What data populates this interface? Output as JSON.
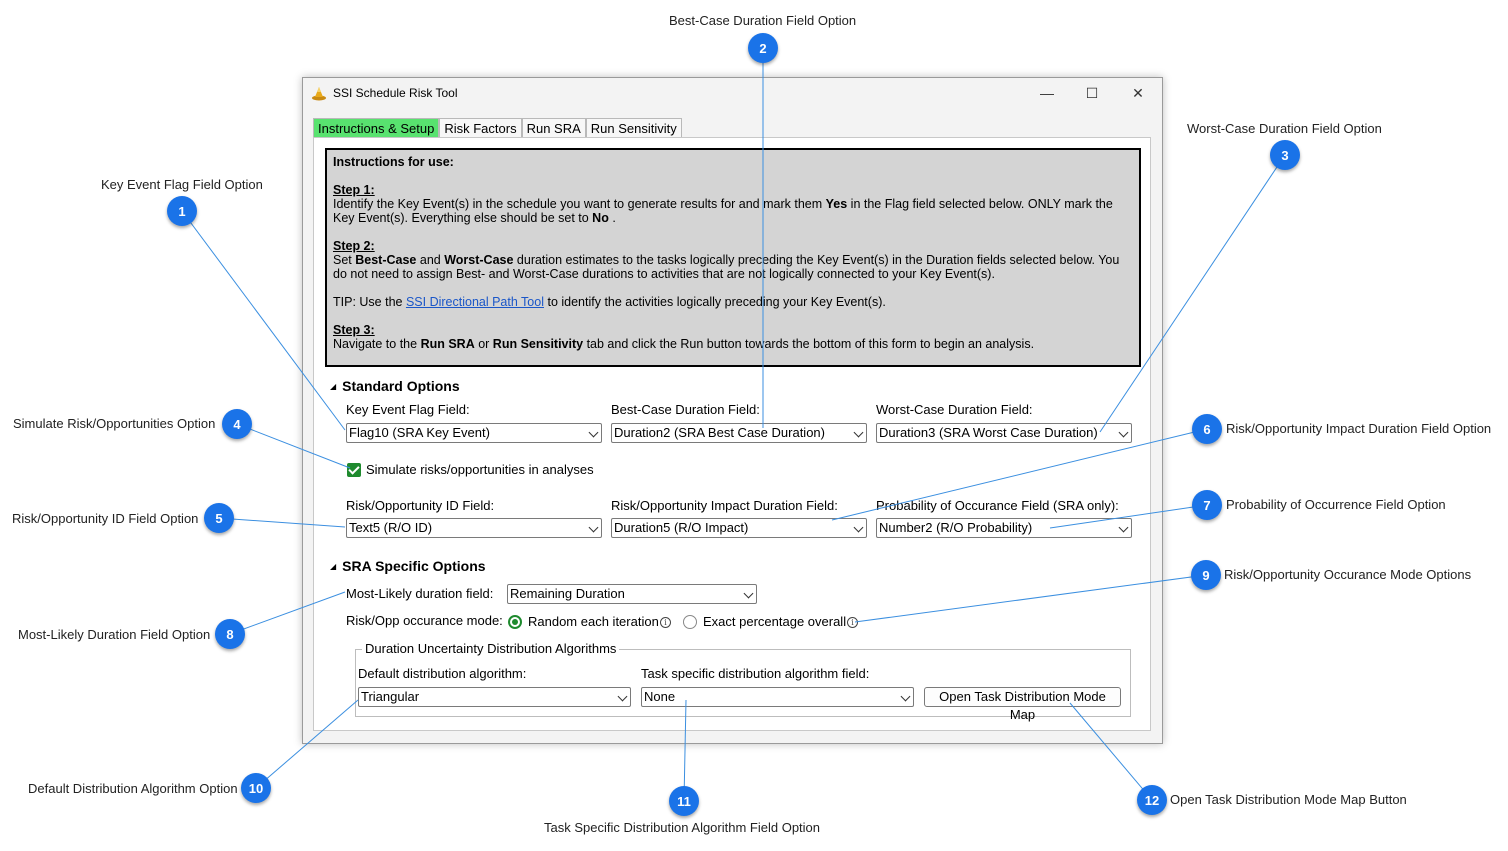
{
  "window": {
    "title": "SSI Schedule Risk Tool",
    "controls": {
      "minimize": "—",
      "maximize": "☐",
      "close": "✕"
    }
  },
  "tabs": [
    "Instructions & Setup",
    "Risk Factors",
    "Run SRA",
    "Run Sensitivity"
  ],
  "instructions": {
    "heading": "Instructions for use:",
    "step1_title": "Step 1:",
    "step1_a": "Identify the Key Event(s) in the schedule you want to generate results for and mark them ",
    "step1_yes": "Yes",
    "step1_b": " in the Flag field selected below. ONLY mark the Key Event(s). Everything else should be set to ",
    "step1_no": "No",
    "step1_c": " .",
    "step2_title": "Step 2:",
    "step2_a": "Set ",
    "step2_best": "Best-Case",
    "step2_and": " and ",
    "step2_worst": "Worst-Case",
    "step2_b": " duration estimates to the tasks logically preceding the Key Event(s) in the Duration fields selected below. You do not need to assign Best- and Worst-Case durations to activities that are not logically connected to your Key Event(s).",
    "tip_a": "TIP: Use the ",
    "tip_link": "SSI Directional Path Tool",
    "tip_b": " to identify the activities logically preceding your Key Event(s).",
    "step3_title": "Step 3:",
    "step3_a": "Navigate to the ",
    "step3_run_sra": "Run SRA",
    "step3_or": " or ",
    "step3_run_sens": "Run Sensitivity",
    "step3_b": " tab and click the Run button towards the bottom of this form to begin an analysis."
  },
  "standard": {
    "title": "Standard Options",
    "key_event_label": "Key Event Flag Field:",
    "key_event_value": "Flag10 (SRA Key Event)",
    "best_label": "Best-Case Duration Field:",
    "best_value": "Duration2 (SRA Best Case Duration)",
    "worst_label": "Worst-Case Duration Field:",
    "worst_value": "Duration3 (SRA Worst Case Duration)",
    "simulate_label": "Simulate risks/opportunities in analyses",
    "ro_id_label": "Risk/Opportunity ID Field:",
    "ro_id_value": "Text5 (R/O ID)",
    "ro_impact_label": "Risk/Opportunity Impact Duration Field:",
    "ro_impact_value": "Duration5 (R/O Impact)",
    "prob_label": "Probability of Occurance Field (SRA only):",
    "prob_value": "Number2 (R/O Probability)"
  },
  "sra": {
    "title": "SRA Specific Options",
    "ml_label": "Most-Likely duration field:",
    "ml_value": "Remaining Duration",
    "mode_label": "Risk/Opp occurance mode:",
    "mode_random": "Random each iteration",
    "mode_exact": "Exact percentage overall",
    "group_title": "Duration Uncertainty Distribution Algorithms",
    "default_label": "Default distribution algorithm:",
    "default_value": "Triangular",
    "task_label": "Task specific distribution algorithm field:",
    "task_value": "None",
    "open_map_button": "Open Task Distribution Mode Map"
  },
  "callouts": [
    {
      "num": "1",
      "label": "Key Event Flag Field Option"
    },
    {
      "num": "2",
      "label": "Best-Case Duration Field Option"
    },
    {
      "num": "3",
      "label": "Worst-Case Duration Field Option"
    },
    {
      "num": "4",
      "label": "Simulate Risk/Opportunities Option"
    },
    {
      "num": "5",
      "label": "Risk/Opportunity ID Field Option"
    },
    {
      "num": "6",
      "label": "Risk/Opportunity Impact Duration Field Option"
    },
    {
      "num": "7",
      "label": "Probability of Occurrence Field Option"
    },
    {
      "num": "8",
      "label": "Most-Likely Duration Field Option"
    },
    {
      "num": "9",
      "label": "Risk/Opportunity Occurance Mode Options"
    },
    {
      "num": "10",
      "label": "Default Distribution Algorithm Option"
    },
    {
      "num": "11",
      "label": "Task Specific Distribution Algorithm Field Option"
    },
    {
      "num": "12",
      "label": "Open Task Distribution Mode Map Button"
    }
  ],
  "colors": {
    "badge": "#1a73e8",
    "active_tab": "#58e26f",
    "leader_line": "#3b8fe0",
    "check_green": "#1e8a2e",
    "link": "#1a56c8"
  }
}
